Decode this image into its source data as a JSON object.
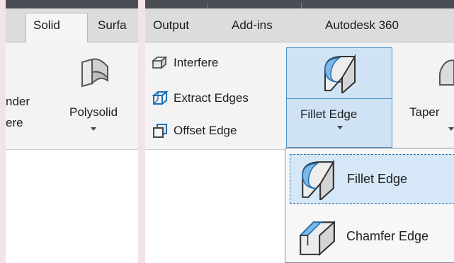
{
  "tabs": {
    "left": [
      {
        "label": "Solid",
        "active": true
      },
      {
        "label": "Surfa"
      }
    ],
    "right": [
      {
        "label": "Output"
      },
      {
        "label": "Add-ins"
      },
      {
        "label": "Autodesk 360"
      }
    ]
  },
  "left_panel": {
    "partial_top": "nder",
    "partial_bottom": "ere",
    "polysolid_label": "Polysolid"
  },
  "right_panel": {
    "interfere_label": "Interfere",
    "extract_edges_label": "Extract Edges",
    "offset_edge_label": "Offset Edge",
    "fillet_edge_label": "Fillet Edge",
    "taper_label": "Taper"
  },
  "dropdown": {
    "items": [
      {
        "label": "Fillet Edge",
        "selected": true
      },
      {
        "label": "Chamfer Edge"
      }
    ]
  },
  "colors": {
    "selection_blue": "#cfe3f5",
    "selection_border": "#4a90c7",
    "icon_blue": "#1f6fb5"
  }
}
